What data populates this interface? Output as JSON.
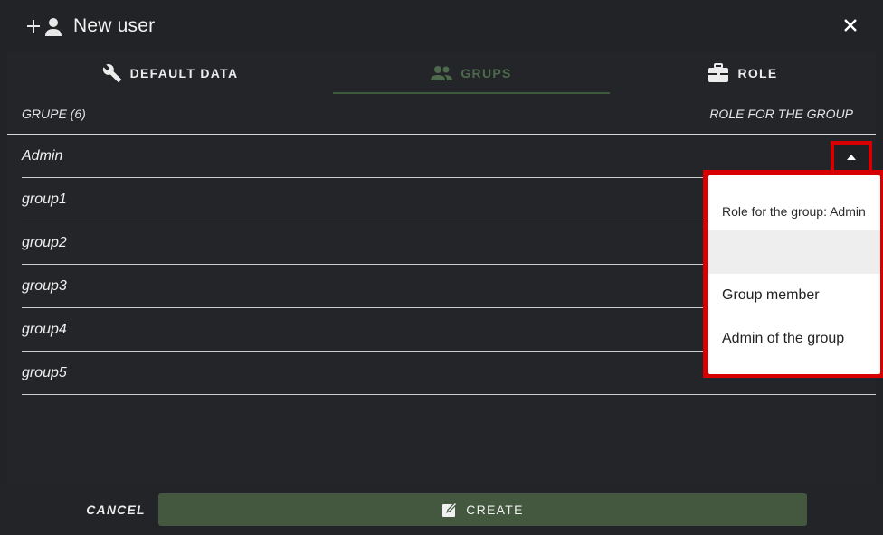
{
  "header": {
    "title": "New user",
    "icons": {
      "add_user": "add-user-icon",
      "close": "close-icon"
    }
  },
  "tabs": [
    {
      "label": "DEFAULT DATA",
      "icon": "wrench-icon",
      "active": false
    },
    {
      "label": "GRUPS",
      "icon": "people-icon",
      "active": true
    },
    {
      "label": "ROLE",
      "icon": "briefcase-icon",
      "active": false
    }
  ],
  "list": {
    "left_header": "GRUPE (6)",
    "right_header": "ROLE FOR THE GROUP",
    "rows": [
      "Admin",
      "group1",
      "group2",
      "group3",
      "group4",
      "group5"
    ]
  },
  "dropdown": {
    "title": "Role for the group: Admin",
    "options": [
      "",
      "Group member",
      "Admin of the group"
    ]
  },
  "footer": {
    "cancel_label": "CANCEL",
    "create_label": "CREATE"
  },
  "colors": {
    "background": "#222327",
    "accent": "#43583f",
    "active_tab": "#4d6a4c",
    "highlight": "#d60000"
  }
}
